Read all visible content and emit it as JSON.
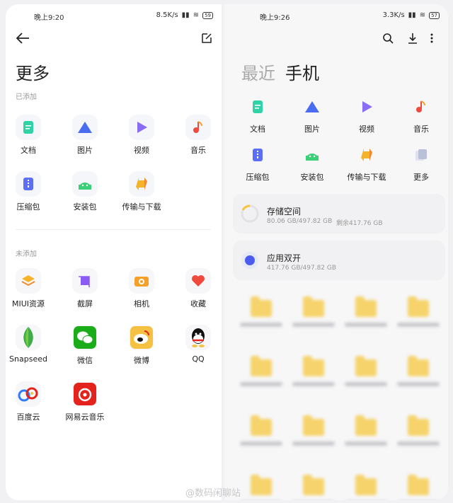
{
  "left": {
    "status": {
      "time": "晚上9:20",
      "speed": "8.5K/s",
      "battery": "59"
    },
    "title": "更多",
    "added_label": "已添加",
    "not_added_label": "未添加",
    "added_items": [
      {
        "label": "文档",
        "icon": "document-icon",
        "color": "#2fd3a5"
      },
      {
        "label": "图片",
        "icon": "picture-icon",
        "color": "#4a6cf0"
      },
      {
        "label": "视频",
        "icon": "video-icon",
        "color": "#8a6cf5"
      },
      {
        "label": "音乐",
        "icon": "music-icon",
        "color": "#f04a3e"
      },
      {
        "label": "压缩包",
        "icon": "archive-icon",
        "color": "#5b6ef5"
      },
      {
        "label": "安装包",
        "icon": "apk-icon",
        "color": "#3ccf7a"
      },
      {
        "label": "传输与下载",
        "icon": "transfer-icon",
        "color": "#f5b32a"
      }
    ],
    "not_added_items": [
      {
        "label": "MIUI资源",
        "icon": "miui-resource-icon",
        "color": "#f5b32a"
      },
      {
        "label": "截屏",
        "icon": "screenshot-icon",
        "color": "#8a5cf5"
      },
      {
        "label": "相机",
        "icon": "camera-icon",
        "color": "#f5a02a"
      },
      {
        "label": "收藏",
        "icon": "favorite-icon",
        "color": "#f04a3e"
      },
      {
        "label": "Snapseed",
        "icon": "snapseed-icon",
        "color": "#3fae49"
      },
      {
        "label": "微信",
        "icon": "wechat-icon",
        "color": "#1aad19"
      },
      {
        "label": "微博",
        "icon": "weibo-icon",
        "color": "#f5c142"
      },
      {
        "label": "QQ",
        "icon": "qq-icon",
        "color": "#111111"
      },
      {
        "label": "百度云",
        "icon": "baidu-cloud-icon",
        "color": "#2f7cf6"
      },
      {
        "label": "网易云音乐",
        "icon": "netease-music-icon",
        "color": "#e5231d"
      }
    ]
  },
  "right": {
    "status": {
      "time": "晚上9:26",
      "speed": "3.3K/s",
      "battery": "57"
    },
    "tab_recent": "最近",
    "tab_phone": "手机",
    "categories": [
      {
        "label": "文档",
        "icon": "document-icon",
        "color": "#2fd3a5"
      },
      {
        "label": "图片",
        "icon": "picture-icon",
        "color": "#4a6cf0"
      },
      {
        "label": "视频",
        "icon": "video-icon",
        "color": "#8a6cf5"
      },
      {
        "label": "音乐",
        "icon": "music-icon",
        "color": "#f04a3e"
      },
      {
        "label": "压缩包",
        "icon": "archive-icon",
        "color": "#5b6ef5"
      },
      {
        "label": "安装包",
        "icon": "apk-icon",
        "color": "#3ccf7a"
      },
      {
        "label": "传输与下载",
        "icon": "transfer-icon",
        "color": "#f5b32a"
      },
      {
        "label": "更多",
        "icon": "more-icon",
        "color": "#b9c0d8"
      }
    ],
    "storage": {
      "title": "存储空间",
      "used": "80.06 GB/497.82 GB",
      "remaining": "剩余417.76 GB"
    },
    "dual_apps": {
      "title": "应用双开",
      "info": "417.76 GB/497.82 GB"
    }
  },
  "watermark": "@数码闲聊站"
}
